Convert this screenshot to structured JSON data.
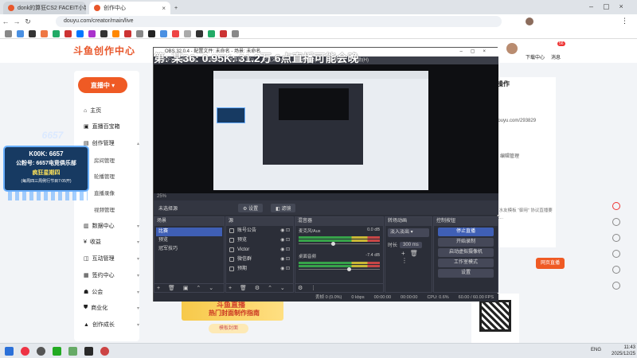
{
  "browser": {
    "tabs": [
      {
        "label": "donk的算狂CS2 FACEIT小镇"
      },
      {
        "label": "创作中心"
      }
    ],
    "new_tab": "+",
    "url": "douyu.com/creator/main/live"
  },
  "site": {
    "logo": "斗鱼创作中心",
    "header_right": {
      "download": "下载中心",
      "messages": "消息",
      "badge_count": "56"
    },
    "live_button": "直播中",
    "sidebar": [
      {
        "label": "主页"
      },
      {
        "label": "直播百宝箱"
      },
      {
        "label": "创作管理"
      },
      {
        "label": "数据中心"
      },
      {
        "label": "收益"
      },
      {
        "label": "互动管理"
      },
      {
        "label": "签约中心"
      },
      {
        "label": "公会"
      },
      {
        "label": "商业化"
      },
      {
        "label": "创作成长"
      }
    ],
    "sidebar_sub": [
      "房间管理",
      "轮播管理",
      "直播录像",
      "视频管理"
    ],
    "right_card": {
      "title": "操作",
      "link": "douyu.com/293829",
      "action": "编辑管理"
    },
    "right_text": "...水友模板 “御用” 协议直播要求...",
    "live_room_button": "网页直播",
    "banner_title": "斗鱼直播",
    "banner_sub": "热门封面制作指南",
    "banner_btn": "模板封面"
  },
  "overlay_badge": {
    "name": "K00K: 6657",
    "line1": "公粉号: 6657电竞俱乐部",
    "line2": "疯狂星期四",
    "line3": "(每周四三周例行节目7:05开)",
    "tag": "6657"
  },
  "scroll_text": "第: 某36: 0.95K: 31.2万 6点直播可能会晚",
  "obs": {
    "title": "OBS 32.0.4 - 配置文件: 未命名 - 场景: 未命名",
    "menu": [
      "文件(F)",
      "编辑(E)",
      "视图(V)",
      "停靠窗口(D)",
      "配置文件(P)",
      "场景集合(S)",
      "工具(T)",
      "帮助(H)"
    ],
    "zoom": "25%",
    "no_source": "未选择源",
    "settings_btn": "设置",
    "filter_btn": "滤镜",
    "scenes_title": "场景",
    "scenes": [
      "比赛",
      "预览",
      "冠军技巧"
    ],
    "sources_title": "源",
    "sources": [
      "账号公告",
      "预览",
      "Victor",
      "微信群",
      "预期"
    ],
    "mixer_title": "混音器",
    "mixer": [
      {
        "name": "麦克风/Aux",
        "db": "0.0 dB"
      },
      {
        "name": "桌面音频",
        "db": "-7.4 dB"
      }
    ],
    "transitions_title": "转场动画",
    "transition": "淡入淡出",
    "duration_label": "时长",
    "duration": "300 ms",
    "controls_title": "控制按钮",
    "controls": [
      "停止直播",
      "开始录制",
      "启动虚拟摄像机",
      "工作室模式",
      "设置"
    ],
    "status": {
      "frames": "丢帧 0 (0.0%)",
      "bitrate": "0 kbps",
      "time1": "00:00:00",
      "time2": "00:00:00",
      "cpu": "CPU: 0.6%",
      "fps": "60.00 / 60.00 FPS"
    }
  },
  "taskbar": {
    "lang": "ENG",
    "time": "11:43",
    "date": "2025/12/25"
  }
}
